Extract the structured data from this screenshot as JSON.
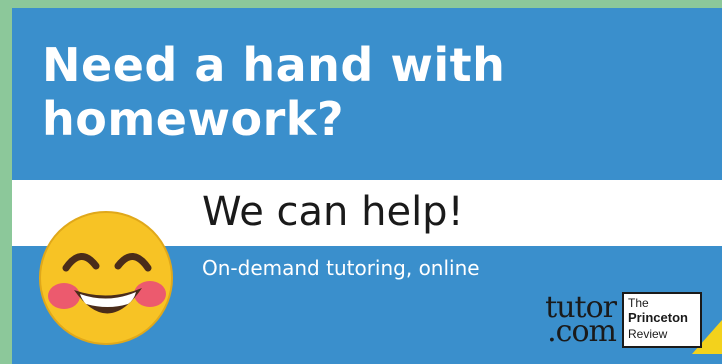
{
  "headline": "Need a hand with homework?",
  "tagline": "We can help!",
  "subtext": "On-demand tutoring, online",
  "logos": {
    "tutor_line1": "tutor",
    "tutor_line2": ".com",
    "pr_the": "The",
    "pr_name": "Princeton",
    "pr_review": "Review"
  },
  "icons": {
    "emoji": "smiling-face-with-closed-eyes-emoji"
  },
  "colors": {
    "banner_blue": "#3a8fcc",
    "frame_green": "#8cc89a",
    "band_white": "#ffffff",
    "emoji_yellow": "#f7c325",
    "cheek_pink": "#ec5a6e",
    "accent_yellow": "#f3d21c"
  }
}
